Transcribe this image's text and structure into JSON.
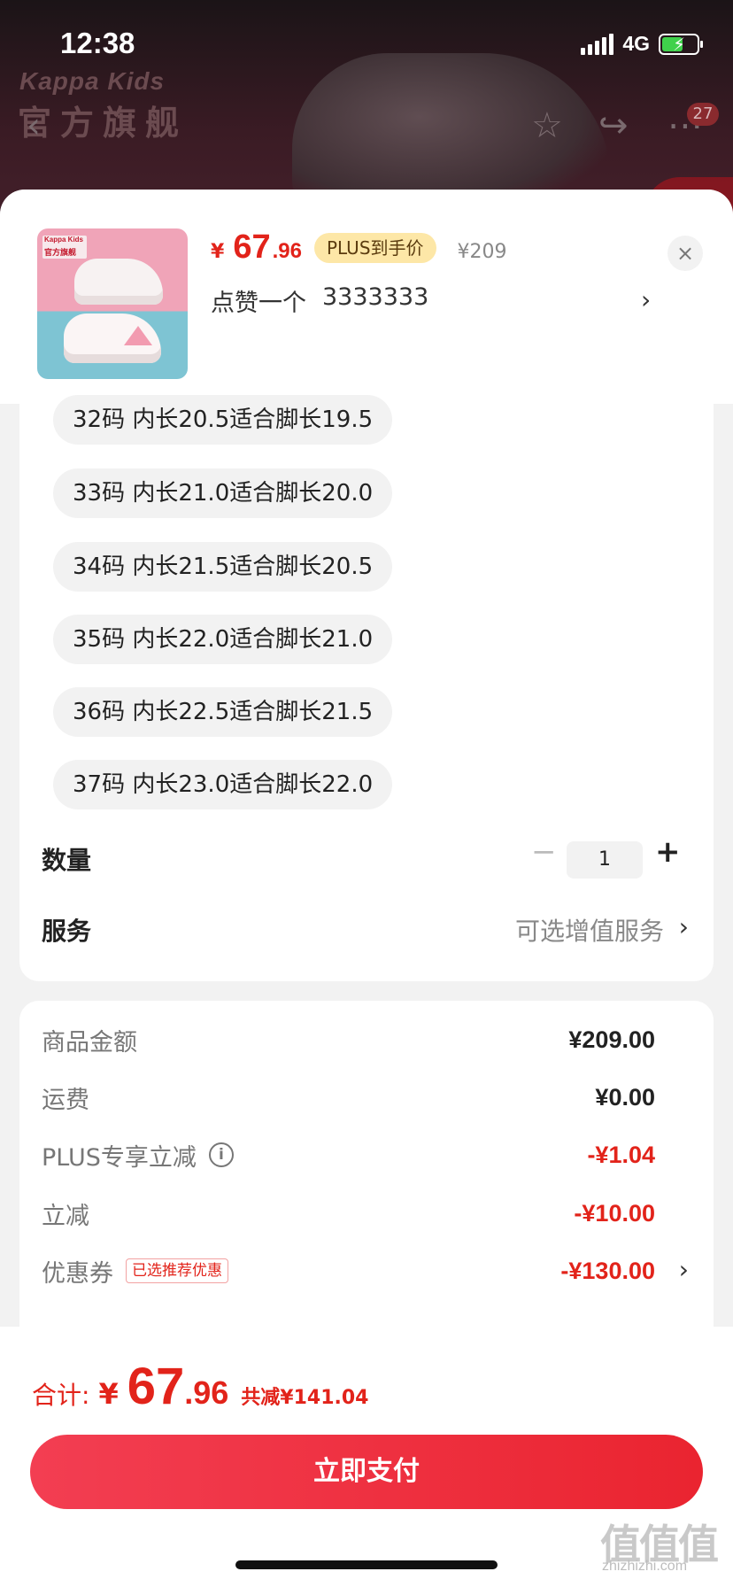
{
  "status_bar": {
    "time": "12:38",
    "network": "4G"
  },
  "background": {
    "brand": "Kappa Kids",
    "store_name": "官方旗舰",
    "notification_count": "27"
  },
  "product": {
    "thumb_brand": "Kappa Kids",
    "thumb_store": "官方旗舰",
    "price_symbol": "¥",
    "price_integer": "67",
    "price_decimal": ".96",
    "plus_badge": "PLUS到手价",
    "original_price": "¥209",
    "spec_text": "点赞一个",
    "spec_value": "3333333",
    "spec_arrow": "›",
    "close": "×"
  },
  "sizes": [
    "32码 内长20.5适合脚长19.5",
    "33码 内长21.0适合脚长20.0",
    "34码 内长21.5适合脚长20.5",
    "35码 内长22.0适合脚长21.0",
    "36码 内长22.5适合脚长21.5",
    "37码 内长23.0适合脚长22.0"
  ],
  "quantity": {
    "label": "数量",
    "minus": "−",
    "value": "1",
    "plus": "+"
  },
  "service": {
    "label": "服务",
    "value": "可选增值服务",
    "arrow": "›"
  },
  "details": {
    "goods_amount_label": "商品金额",
    "goods_amount_value": "¥209.00",
    "shipping_label": "运费",
    "shipping_value": "¥0.00",
    "plus_discount_label": "PLUS专享立减",
    "plus_discount_value": "-¥1.04",
    "instant_discount_label": "立减",
    "instant_discount_value": "-¥10.00",
    "coupon_label": "优惠券",
    "coupon_tag": "已选推荐优惠",
    "coupon_value": "-¥130.00",
    "coupon_arrow": "›"
  },
  "footer": {
    "total_label": "合计:",
    "total_symbol": "¥",
    "total_integer": "67",
    "total_decimal": ".96",
    "total_saved": "共减¥141.04",
    "pay_button": "立即支付",
    "watermark_logo": "值值值",
    "watermark_url": "zhizhizhi.com"
  },
  "colors": {
    "accent_red": "#e2231a",
    "plus_badge_bg": "#fde7a7",
    "pay_button": "#ea2430"
  },
  "icons": [
    "back-icon",
    "star-icon",
    "share-icon",
    "more-icon",
    "close-icon",
    "info-icon",
    "chevron-right-icon"
  ]
}
